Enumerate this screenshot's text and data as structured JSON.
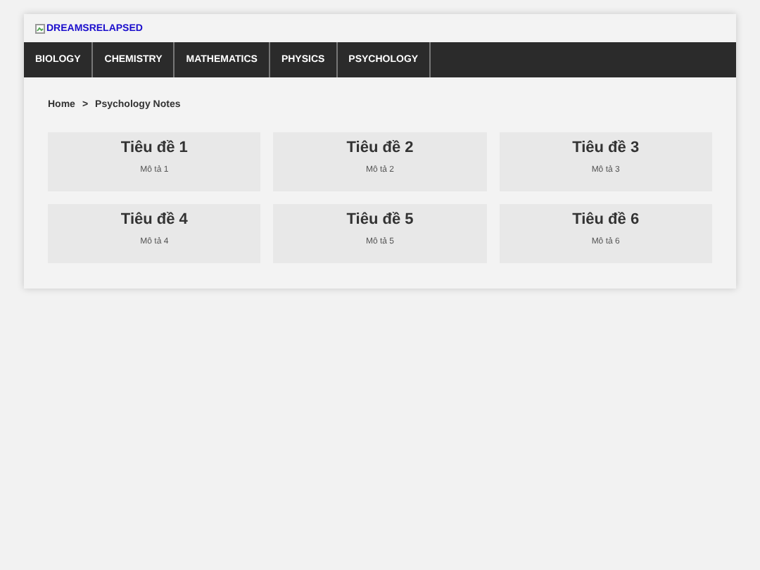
{
  "logo": {
    "text": "DREAMSRELAPSED"
  },
  "nav": [
    {
      "label": "BIOLOGY"
    },
    {
      "label": "CHEMISTRY"
    },
    {
      "label": "MATHEMATICS"
    },
    {
      "label": "PHYSICS"
    },
    {
      "label": "PSYCHOLOGY"
    }
  ],
  "breadcrumb": {
    "home": "Home",
    "separator": ">",
    "current": "Psychology Notes"
  },
  "cards": [
    {
      "title": "Tiêu đề 1",
      "description": "Mô tả 1"
    },
    {
      "title": "Tiêu đề 2",
      "description": "Mô tả 2"
    },
    {
      "title": "Tiêu đề 3",
      "description": "Mô tả 3"
    },
    {
      "title": "Tiêu đề 4",
      "description": "Mô tả 4"
    },
    {
      "title": "Tiêu đề 5",
      "description": "Mô tả 5"
    },
    {
      "title": "Tiêu đề 6",
      "description": "Mô tả 6"
    }
  ]
}
